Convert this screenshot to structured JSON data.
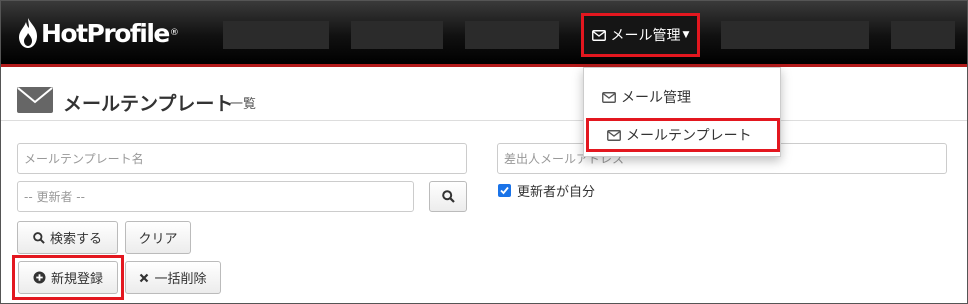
{
  "header": {
    "logo_text": "HotProfile",
    "logo_reg": "®",
    "mail_menu_label": "メール管理"
  },
  "page": {
    "title": "メールテンプレート",
    "subtitle": "一覧"
  },
  "search": {
    "template_name_placeholder": "メールテンプレート名",
    "sender_placeholder": "差出人メールアドレス",
    "updater_placeholder": "-- 更新者 --",
    "self_updater_label": "更新者が自分",
    "self_updater_checked": true,
    "search_button_label": "検索する",
    "clear_button_label": "クリア"
  },
  "actions": {
    "new_button_label": "新規登録",
    "bulk_delete_label": "一括削除"
  },
  "dropdown": {
    "items": [
      {
        "label": "メール管理"
      },
      {
        "label": "メールテンプレート"
      }
    ]
  },
  "colors": {
    "highlight": "#e3171f",
    "header_bg": "#111111",
    "header_accent": "#b31b1b",
    "checkbox": "#1a73e8"
  },
  "icons": {
    "mail": "envelope-icon",
    "search": "magnifier-icon",
    "add": "plus-circle-icon",
    "delete": "x-icon"
  }
}
